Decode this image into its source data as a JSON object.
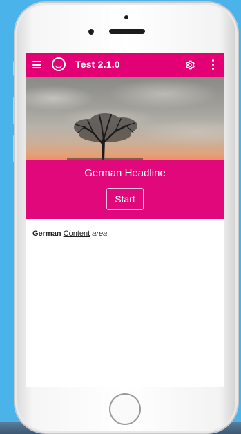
{
  "app": {
    "title": "Test 2.1.0",
    "accent_color": "#e20074"
  },
  "toolbar": {
    "menu_icon": "hamburger-menu-icon",
    "logo_icon": "app-logo-icon",
    "settings_icon": "gear-icon",
    "more_icon": "more-vertical-icon"
  },
  "hero": {
    "headline": "German Headline",
    "start_label": "Start"
  },
  "content": {
    "bold_word": "German",
    "underlined_word": "Content",
    "italic_word": "area"
  }
}
